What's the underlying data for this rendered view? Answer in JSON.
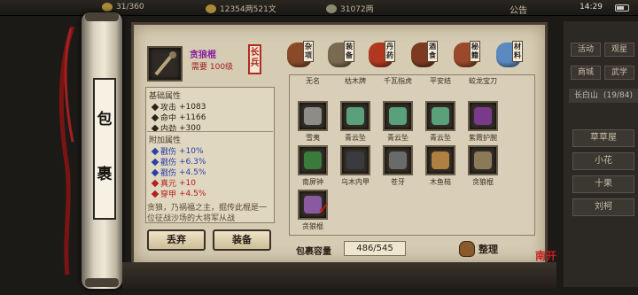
{
  "topbar": {
    "res1": "31/360",
    "res2": "12354两521文",
    "res3": "31072两",
    "notice": "公告",
    "time": "14:29"
  },
  "sidemenu": {
    "btn1": "活动",
    "btn2": "观星",
    "btn3": "商城",
    "btn4": "武学",
    "btn5": "长白山",
    "btn5_sub": "(19/84)",
    "wide1": "草草屋",
    "wide2": "小花",
    "wide3": "十果",
    "wide4": "刘柯"
  },
  "scroll": {
    "char1": "包",
    "char2": "裹"
  },
  "detail": {
    "name": "贪狼棍",
    "requirement": "需要 100级",
    "seal": "长兵",
    "base_title": "基础属性",
    "base_stats": [
      {
        "k": "攻击",
        "v": "+1083"
      },
      {
        "k": "命中",
        "v": "+1166"
      },
      {
        "k": "内劲",
        "v": "+300"
      }
    ],
    "extra_title": "附加属性",
    "extra_stats": [
      {
        "k": "戳伤",
        "v": "+10%",
        "c": "blue"
      },
      {
        "k": "戳伤",
        "v": "+6.3%",
        "c": "blue"
      },
      {
        "k": "戳伤",
        "v": "+4.5%",
        "c": "blue"
      },
      {
        "k": "真元",
        "v": "+10",
        "c": "red"
      },
      {
        "k": "穿甲",
        "v": "+4.5%",
        "c": "red"
      }
    ],
    "description": "贪狼，乃祸福之主，掘传此棍是一位征战沙场的大将军从战"
  },
  "buttons": {
    "discard": "丢弃",
    "equip": "装备"
  },
  "tabs": [
    {
      "label": "杂项",
      "color": "#8a4a2a"
    },
    {
      "label": "装备",
      "color": "#7a6a52"
    },
    {
      "label": "丹药",
      "color": "#b03820"
    },
    {
      "label": "酒食",
      "color": "#7c3a22"
    },
    {
      "label": "秘籍",
      "color": "#9a4a2a"
    },
    {
      "label": "材料",
      "color": "#5b8ac0"
    }
  ],
  "grid_items": [
    {
      "name": "无名",
      "color": "#b9a27a"
    },
    {
      "name": "枯木牌",
      "color": "#6a5a3a"
    },
    {
      "name": "千瓦指虎",
      "color": "#8a7a5a"
    },
    {
      "name": "平安结",
      "color": "#a03030"
    },
    {
      "name": "蛟龙宝刀",
      "color": "#9a8a5a"
    },
    {
      "name": "雪夷",
      "color": "#8e8c86"
    },
    {
      "name": "青云坠",
      "color": "#5aa07a"
    },
    {
      "name": "青云坠",
      "color": "#5aa07a"
    },
    {
      "name": "青云坠",
      "color": "#5aa07a"
    },
    {
      "name": "紫霞护腕",
      "color": "#7a3a8a"
    },
    {
      "name": "南屏钟",
      "color": "#3a7a3a"
    },
    {
      "name": "乌木内甲",
      "color": "#3a3a40"
    },
    {
      "name": "苍牙",
      "color": "#6a6a6a"
    },
    {
      "name": "木鱼槌",
      "color": "#b08040"
    },
    {
      "name": "贪狼棍",
      "color": "#8a7a5a"
    },
    {
      "name": "贪狼棍",
      "color": "#8a5aa0"
    }
  ],
  "capacity": {
    "label": "包裹容量",
    "value": "486/545"
  },
  "sort_label": "整理",
  "stamp": "南开"
}
